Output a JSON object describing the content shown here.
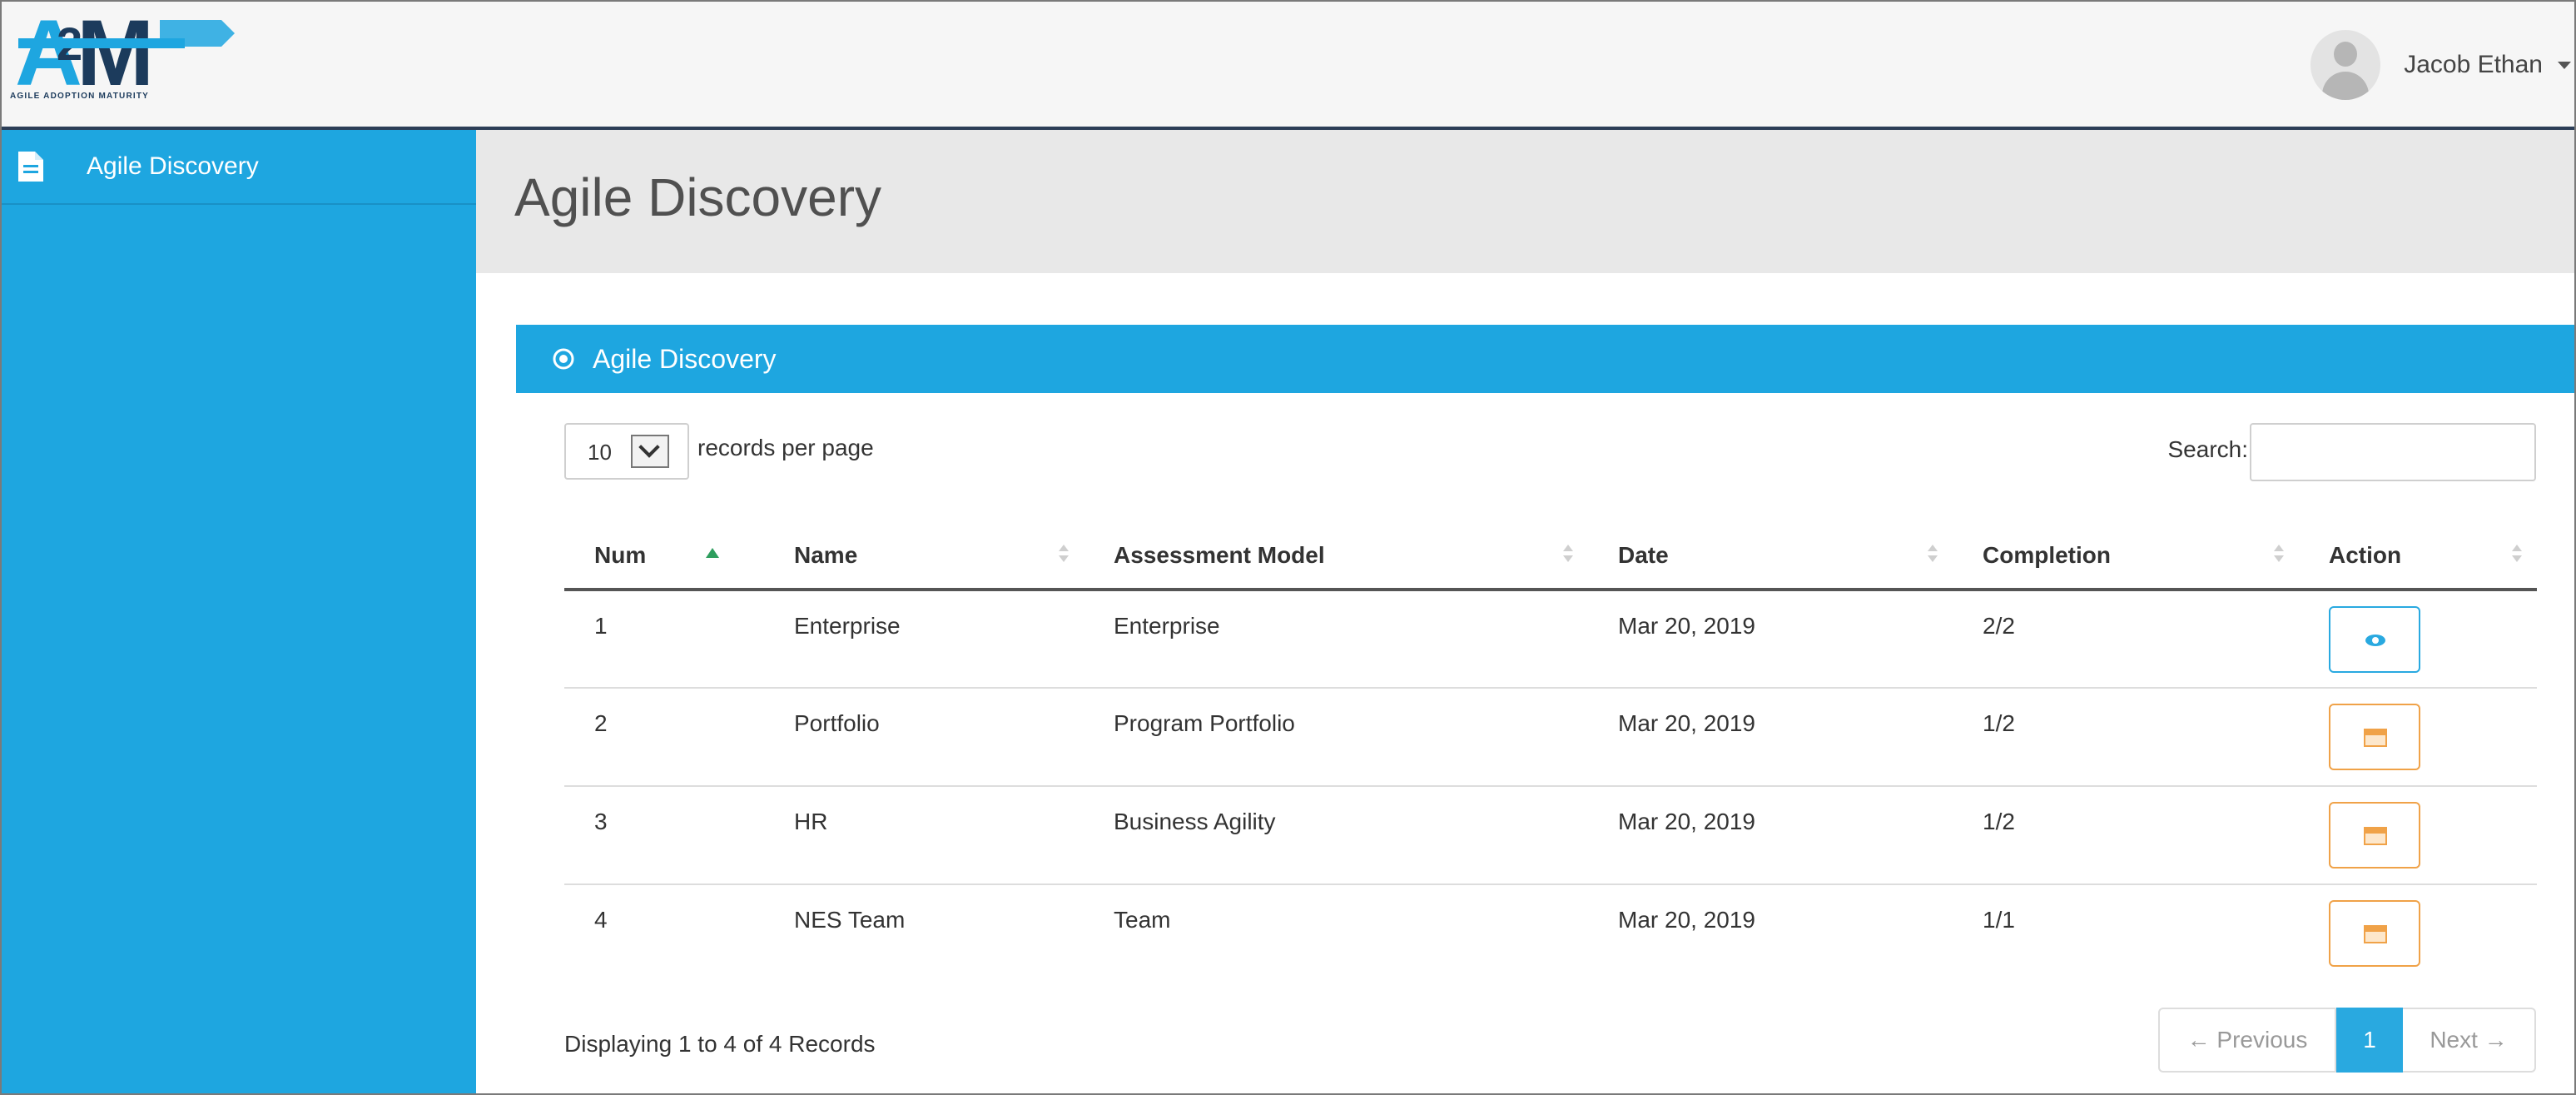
{
  "header": {
    "logo_text": "A2M",
    "logo_tagline": "AGILE ADOPTION MATURITY",
    "user_name": "Jacob Ethan",
    "user_menu_icon": "caret-down-icon",
    "avatar_icon": "user-avatar-icon"
  },
  "sidebar": {
    "items": [
      {
        "label": "Agile Discovery",
        "icon": "document-icon"
      }
    ]
  },
  "page": {
    "title": "Agile Discovery"
  },
  "panel": {
    "title": "Agile Discovery",
    "title_icon": "target-icon",
    "page_length": "10",
    "page_length_label": "records per page",
    "search_label": "Search:",
    "search_value": "",
    "columns": [
      "Num",
      "Name",
      "Assessment Model",
      "Date",
      "Completion",
      "Action"
    ],
    "sorted_column": "Num",
    "rows": [
      {
        "num": "1",
        "name": "Enterprise",
        "model": "Enterprise",
        "date": "Mar 20, 2019",
        "completion": "2/2",
        "action_icon": "eye-icon"
      },
      {
        "num": "2",
        "name": "Portfolio",
        "model": "Program Portfolio",
        "date": "Mar 20, 2019",
        "completion": "1/2",
        "action_icon": "calendar-icon"
      },
      {
        "num": "3",
        "name": "HR",
        "model": "Business Agility",
        "date": "Mar 20, 2019",
        "completion": "1/2",
        "action_icon": "calendar-icon"
      },
      {
        "num": "4",
        "name": "NES Team",
        "model": "Team",
        "date": "Mar 20, 2019",
        "completion": "1/1",
        "action_icon": "calendar-icon"
      }
    ],
    "footer_info": "Displaying 1 to 4 of 4 Records",
    "pagination": {
      "previous": "← Previous",
      "current": "1",
      "next": "Next →"
    }
  },
  "colors": {
    "accent": "#1ea6e0",
    "header_border": "#2c3e57",
    "view_button": "#29a9e0",
    "edit_button": "#f0a248",
    "sort_asc": "#2e9e5e"
  }
}
